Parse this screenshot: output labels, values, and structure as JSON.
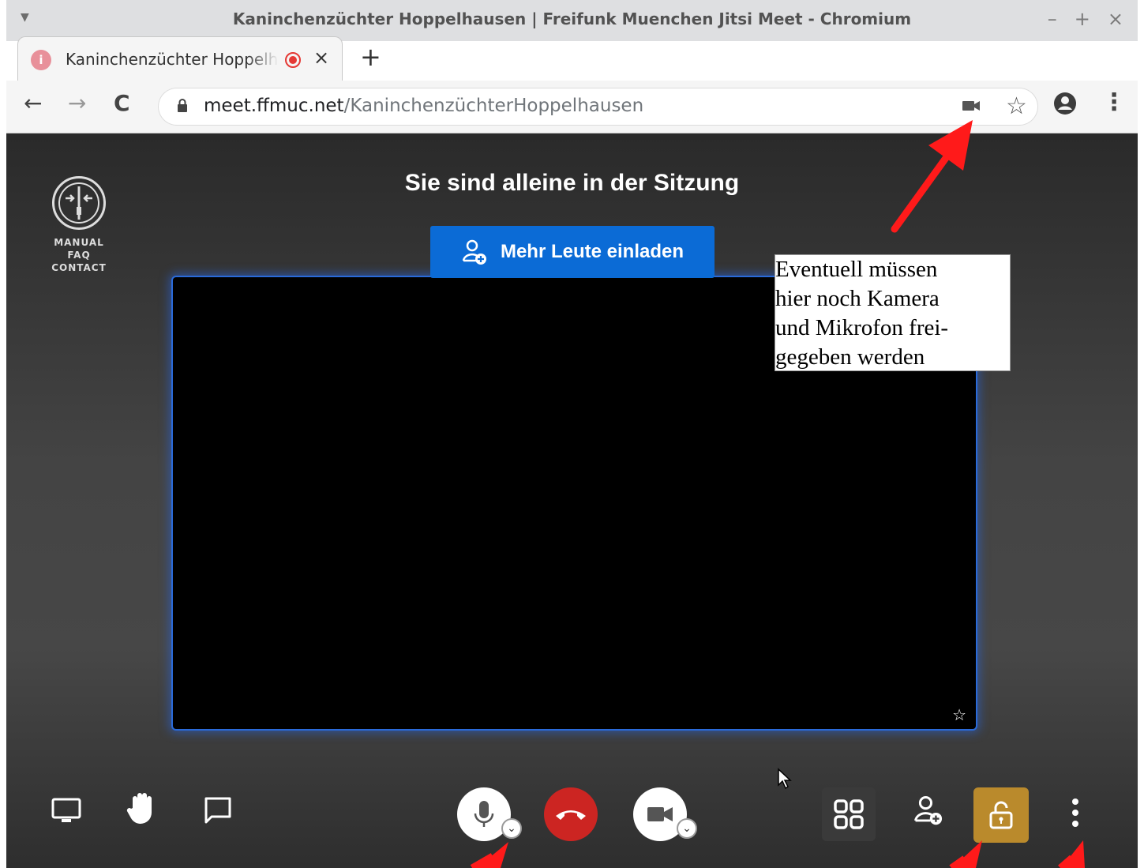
{
  "window": {
    "title": "Kaninchenzüchter Hoppelhausen | Freifunk Muenchen Jitsi Meet - Chromium",
    "controls": [
      "–",
      "+",
      "×"
    ]
  },
  "tab": {
    "title": "Kaninchenzüchter Hoppelhausen",
    "favicon": "i",
    "recording": true,
    "close": "×",
    "new_tab": "+"
  },
  "toolbar": {
    "back": "←",
    "forward": "→",
    "reload": "C",
    "url_domain": "meet.ffmuc.net",
    "url_path": "/KaninchenzüchterHoppelhausen",
    "bookmark_star": "☆",
    "menu": "⋮"
  },
  "sidebar_logo": {
    "lines": [
      "MANUAL",
      "FAQ",
      "CONTACT"
    ]
  },
  "meeting": {
    "heading": "Sie sind alleine in der Sitzung",
    "invite_label": "Mehr Leute einladen",
    "video_star": "☆"
  },
  "annotation": {
    "lines": [
      "Eventuell müssen",
      "hier noch Kamera",
      "und Mikrofon frei-",
      "gegeben werden"
    ],
    "arrow_color": "#ff1a1a"
  },
  "bottom_toolbar": {
    "left": [
      "screen-share-icon",
      "raise-hand-icon",
      "chat-icon"
    ],
    "center": [
      "microphone-icon",
      "hangup-icon",
      "camera-icon"
    ],
    "right": [
      "tile-view-icon",
      "invite-icon",
      "security-icon",
      "more-options-icon"
    ],
    "caret": "⌄"
  },
  "colors": {
    "accent": "#0b6bd6",
    "hangup": "#cc2522",
    "security": "#ba8a2c",
    "video_border": "#2a6ad9"
  }
}
